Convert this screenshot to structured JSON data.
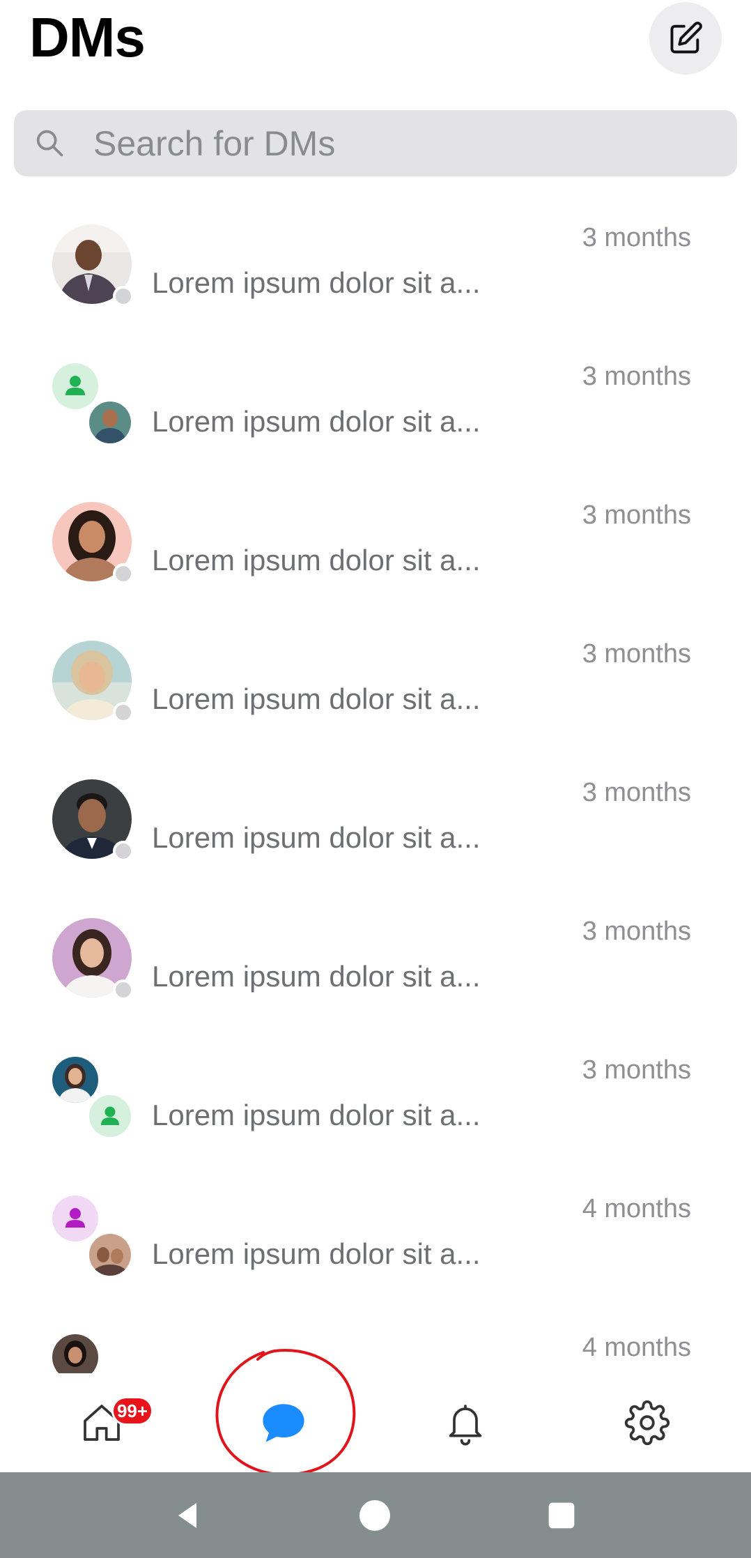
{
  "header": {
    "title": "DMs",
    "compose_icon": "compose-icon"
  },
  "search": {
    "placeholder": "Search for DMs",
    "value": "",
    "icon": "search-icon"
  },
  "dms": [
    {
      "type": "single",
      "avatar": "photo-man-suit",
      "time": "3 months",
      "preview": "Lorem ipsum dolor sit a..."
    },
    {
      "type": "group",
      "avatar": "green-person-and-photo",
      "time": "3 months",
      "preview": "Lorem ipsum dolor sit a..."
    },
    {
      "type": "single",
      "avatar": "photo-woman-curly",
      "time": "3 months",
      "preview": "Lorem ipsum dolor sit a..."
    },
    {
      "type": "single",
      "avatar": "photo-woman-blonde",
      "time": "3 months",
      "preview": "Lorem ipsum dolor sit a..."
    },
    {
      "type": "single",
      "avatar": "photo-man-beard",
      "time": "3 months",
      "preview": "Lorem ipsum dolor sit a..."
    },
    {
      "type": "single",
      "avatar": "photo-woman-purple-bg",
      "time": "3 months",
      "preview": "Lorem ipsum dolor sit a..."
    },
    {
      "type": "group",
      "avatar": "photo-and-green-person",
      "time": "3 months",
      "preview": "Lorem ipsum dolor sit a..."
    },
    {
      "type": "group",
      "avatar": "purple-person-and-photo",
      "time": "4 months",
      "preview": "Lorem ipsum dolor sit a..."
    },
    {
      "type": "single",
      "avatar": "photo-woman-dark-hair",
      "time": "4 months",
      "preview": ""
    }
  ],
  "bottom_nav": {
    "items": [
      {
        "icon": "home-icon",
        "active": false
      },
      {
        "icon": "chat-bubble-icon",
        "active": true
      },
      {
        "icon": "bell-icon",
        "active": false
      },
      {
        "icon": "gear-icon",
        "active": false
      }
    ],
    "badge": "99+"
  },
  "system_nav": [
    "back-icon",
    "home-circle-icon",
    "recents-icon"
  ],
  "colors": {
    "accent": "#1a8cff",
    "badge": "#e8131b",
    "annotation": "#e0151b",
    "green_avatar": "#1fb153",
    "purple_avatar": "#b31cc4"
  }
}
